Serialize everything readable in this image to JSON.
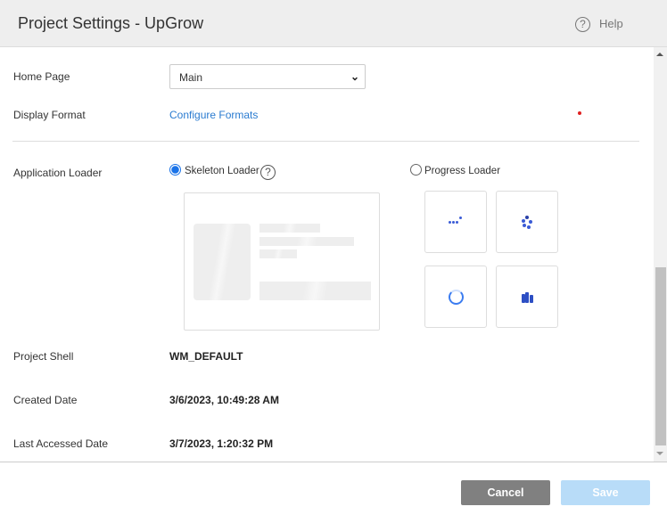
{
  "header": {
    "title": "Project Settings - UpGrow",
    "help_label": "Help"
  },
  "fields": {
    "home_page": {
      "label": "Home Page",
      "value": "Main"
    },
    "display_format": {
      "label": "Display Format",
      "link": "Configure Formats"
    },
    "application_loader": {
      "label": "Application Loader",
      "options": [
        {
          "label": "Skeleton Loader",
          "selected": true
        },
        {
          "label": "Progress Loader",
          "selected": false
        }
      ]
    },
    "project_shell": {
      "label": "Project Shell",
      "value": "WM_DEFAULT"
    },
    "created_date": {
      "label": "Created Date",
      "value": "3/6/2023, 10:49:28 AM"
    },
    "last_accessed_date": {
      "label": "Last Accessed Date",
      "value": "3/7/2023, 1:20:32 PM"
    }
  },
  "footer": {
    "cancel_label": "Cancel",
    "save_label": "Save"
  },
  "colors": {
    "accent": "#1a73e8",
    "link": "#2a7bd0",
    "cancel": "#808080",
    "save_disabled": "#b8dcf8"
  }
}
